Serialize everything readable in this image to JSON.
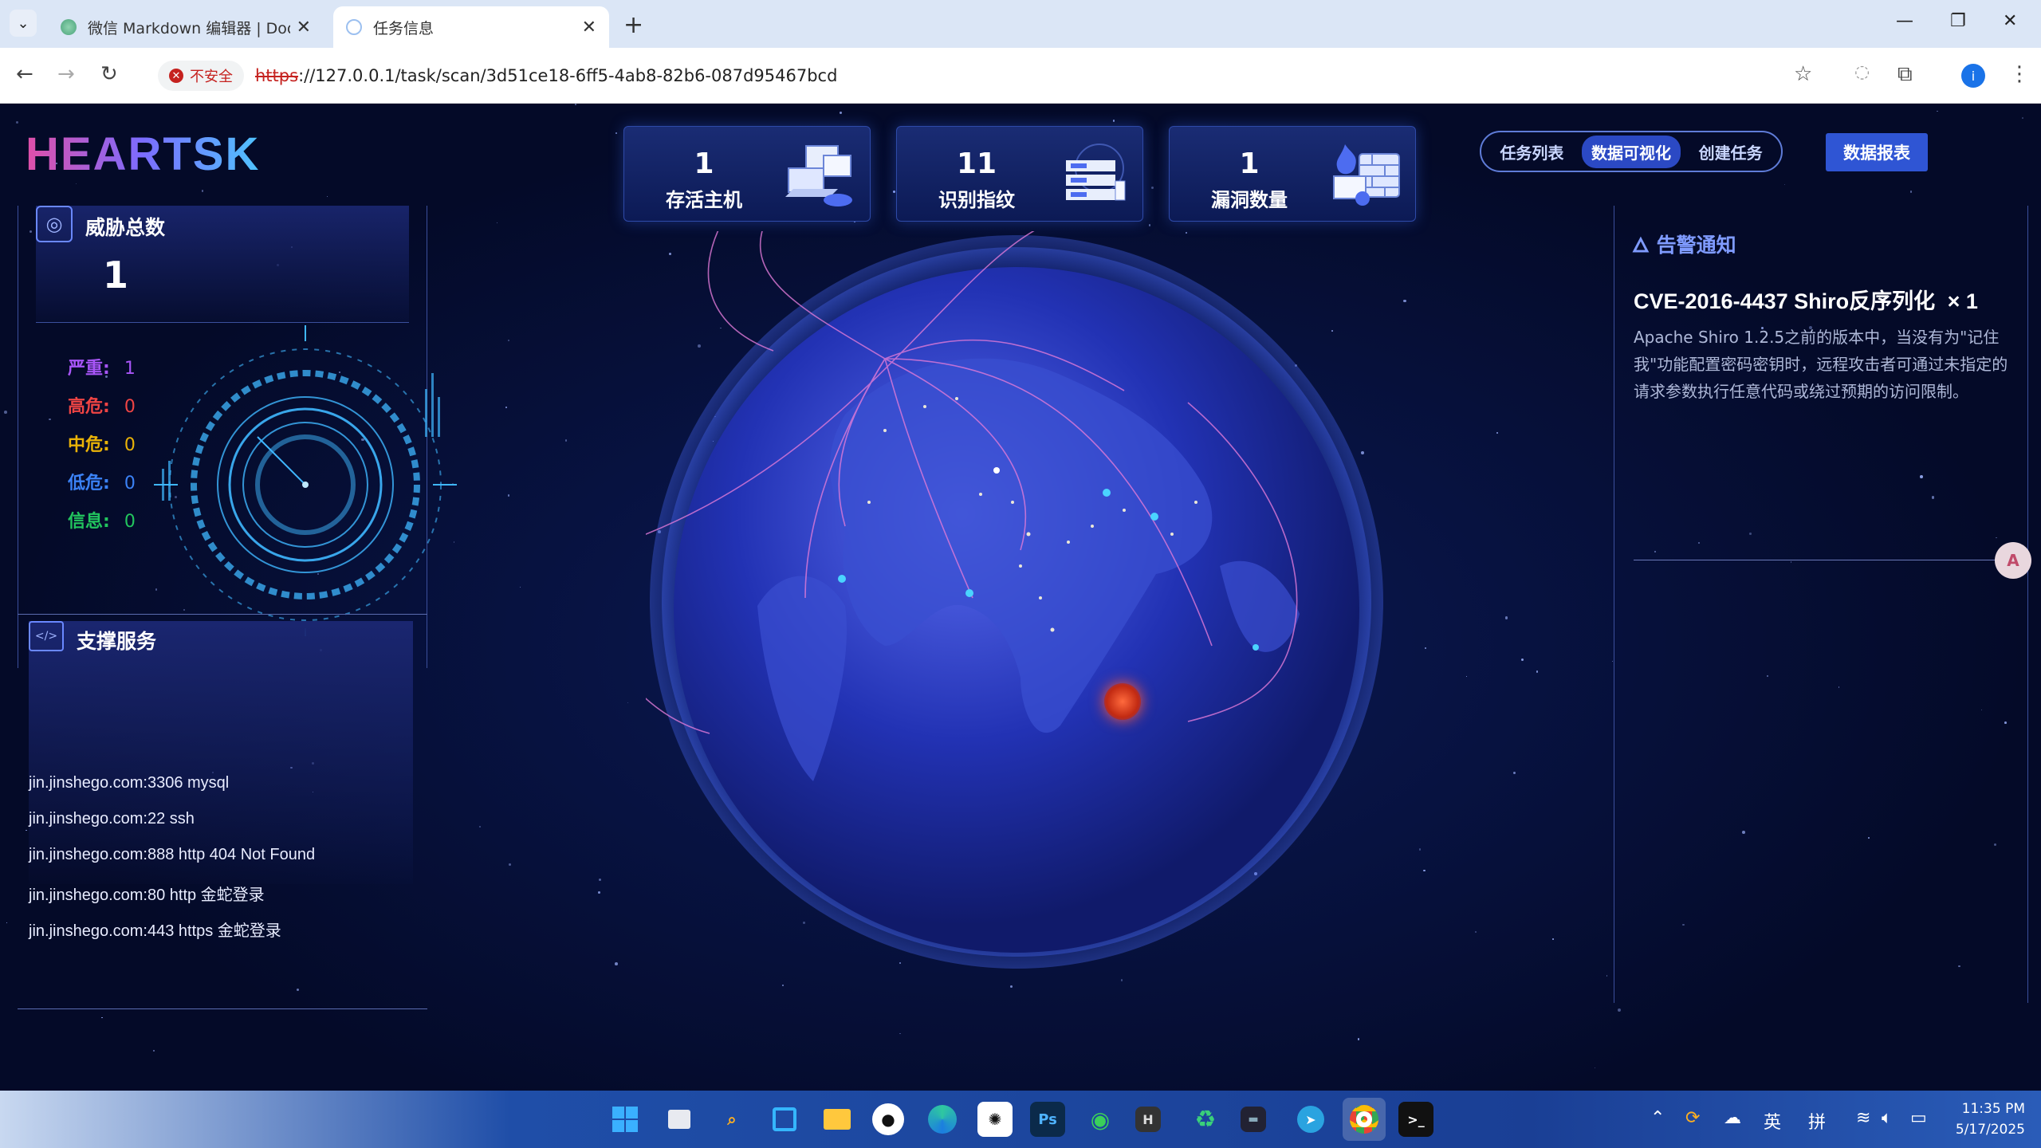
{
  "browser": {
    "tabs": [
      {
        "title": "微信 Markdown 编辑器 | Doo",
        "active": false
      },
      {
        "title": "任务信息",
        "active": true
      }
    ],
    "security_label": "不安全",
    "url_scheme": "https",
    "url_rest": "://127.0.0.1/task/scan/3d51ce18-6ff5-4ab8-82b6-087d95467bcd",
    "profile_initial": "i"
  },
  "header": {
    "logo": "HEARTSK",
    "stats": [
      {
        "value": "1",
        "label": "存活主机",
        "icon": "computer-cluster-icon"
      },
      {
        "value": "11",
        "label": "识别指纹",
        "icon": "fingerprint-server-icon"
      },
      {
        "value": "1",
        "label": "漏洞数量",
        "icon": "vulnerability-firewall-icon"
      }
    ],
    "nav": [
      {
        "label": "任务列表",
        "active": false
      },
      {
        "label": "数据可视化",
        "active": true
      },
      {
        "label": "创建任务",
        "active": false
      }
    ],
    "report_button": "数据报表"
  },
  "threat": {
    "title": "威胁总数",
    "total": "1",
    "levels": [
      {
        "label": "严重:",
        "value": "1",
        "color": "#a855f7"
      },
      {
        "label": "高危:",
        "value": "0",
        "color": "#ef4444"
      },
      {
        "label": "中危:",
        "value": "0",
        "color": "#eab308"
      },
      {
        "label": "低危:",
        "value": "0",
        "color": "#3b82f6"
      },
      {
        "label": "信息:",
        "value": "0",
        "color": "#22c55e"
      }
    ]
  },
  "support": {
    "title": "支撑服务",
    "services": [
      "jin.jinshego.com:3306 mysql",
      "jin.jinshego.com:22 ssh",
      "jin.jinshego.com:888 http 404 Not Found",
      "jin.jinshego.com:80 http 金蛇登录",
      "jin.jinshego.com:443 https 金蛇登录"
    ]
  },
  "alerts": {
    "title": "告警通知",
    "items": [
      {
        "title": "CVE-2016-4437 Shiro反序列化",
        "count": "× 1",
        "description": "Apache Shiro 1.2.5之前的版本中，当没有为\"记住我\"功能配置密码密钥时，远程攻击者可通过未指定的请求参数执行任意代码或绕过预期的访问限制。"
      }
    ]
  },
  "translate_label": "A",
  "taskbar": {
    "time": "11:35 PM",
    "date": "5/17/2025",
    "ime_lang": "英",
    "ime_mode": "拼"
  }
}
